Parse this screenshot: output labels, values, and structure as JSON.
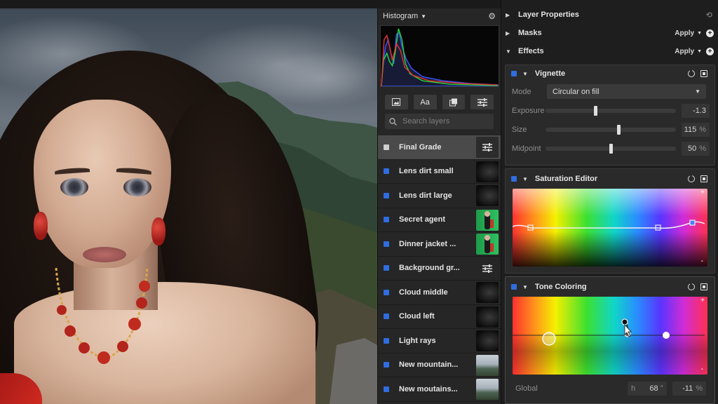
{
  "histogram": {
    "title": "Histogram"
  },
  "toolbar": {
    "text_tool_label": "Aa"
  },
  "search": {
    "placeholder": "Search layers"
  },
  "layers": [
    {
      "name": "Final Grade",
      "selected": true,
      "thumb": "adjust-icon"
    },
    {
      "name": "Lens dirt small",
      "thumb": "dark-photo"
    },
    {
      "name": "Lens dirt large",
      "thumb": "dark-photo"
    },
    {
      "name": "Secret agent",
      "thumb": "green-screen"
    },
    {
      "name": "Dinner jacket ...",
      "thumb": "green-screen"
    },
    {
      "name": "Background gr...",
      "thumb": "adjust-icon"
    },
    {
      "name": "Cloud middle",
      "thumb": "dark-photo"
    },
    {
      "name": "Cloud left",
      "thumb": "dark-photo"
    },
    {
      "name": "Light rays",
      "thumb": "dark-photo"
    },
    {
      "name": "New mountain...",
      "thumb": "mountain-photo"
    },
    {
      "name": "New moutains...",
      "thumb": "mountain-photo"
    }
  ],
  "sections": {
    "layer_properties": "Layer Properties",
    "masks": "Masks",
    "effects": "Effects",
    "apply_label": "Apply"
  },
  "vignette": {
    "title": "Vignette",
    "mode_label": "Mode",
    "mode_value": "Circular on fill",
    "exposure_label": "Exposure",
    "exposure_value": "-1.3",
    "exposure_level": 0.38,
    "size_label": "Size",
    "size_value": "115",
    "size_unit": "%",
    "size_level": 0.56,
    "midpoint_label": "Midpoint",
    "midpoint_value": "50",
    "midpoint_unit": "%",
    "midpoint_level": 0.5
  },
  "saturation_editor": {
    "title": "Saturation Editor",
    "plus": "+",
    "minus": "-"
  },
  "tone_coloring": {
    "title": "Tone Coloring",
    "plus": "+",
    "minus": "-",
    "global_label": "Global",
    "h_label": "h",
    "h_value": "68",
    "h_unit": "°",
    "s_value": "-11",
    "s_unit": "%"
  },
  "colors": {
    "accent": "#2f6de0",
    "panel": "#262626",
    "selected_row": "#4a4a4a"
  }
}
